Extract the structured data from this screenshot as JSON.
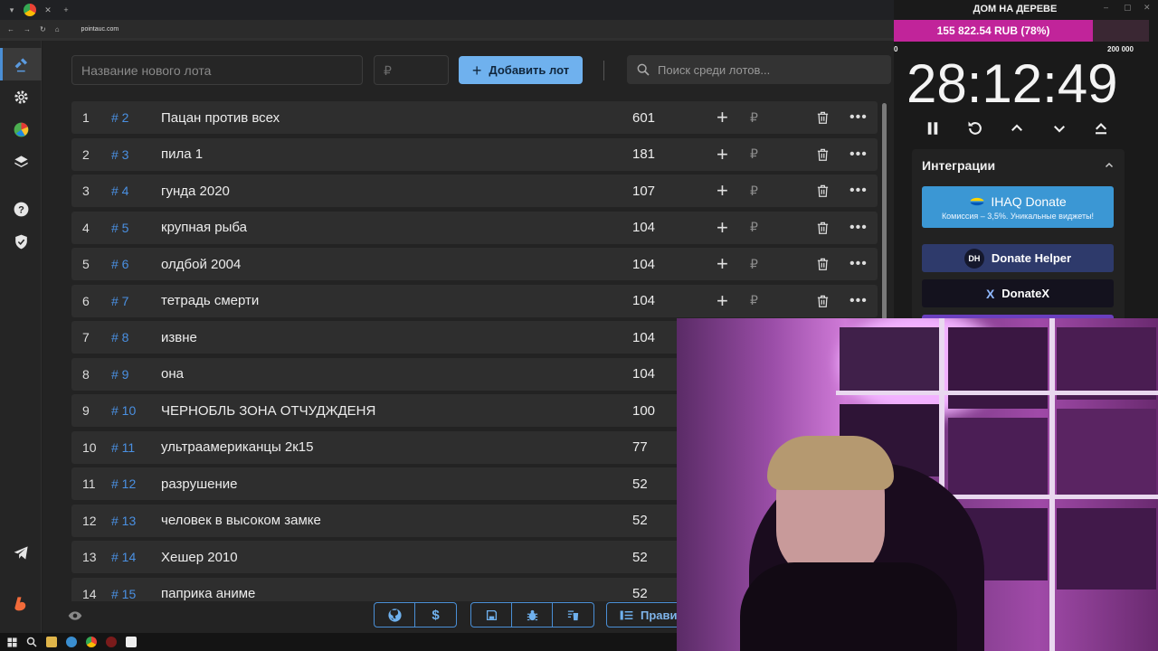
{
  "browser": {
    "url": "pointauc.com"
  },
  "sidebar": {
    "items": [
      {
        "icon": "gavel-icon",
        "active": true
      },
      {
        "icon": "gear-icon"
      },
      {
        "icon": "pie-chart-icon"
      },
      {
        "icon": "layers-icon"
      },
      {
        "icon": "help-icon"
      },
      {
        "icon": "shield-icon"
      },
      {
        "icon": "telegram-icon"
      },
      {
        "icon": "boosty-icon"
      }
    ]
  },
  "toolbar": {
    "lot_name_placeholder": "Название нового лота",
    "amount_placeholder": "₽",
    "add_label": "Добавить лот",
    "search_placeholder": "Поиск среди лотов..."
  },
  "lots": [
    {
      "index": "1",
      "id": "# 2",
      "name": "Пацан против всех",
      "amount": "601"
    },
    {
      "index": "2",
      "id": "# 3",
      "name": "пила 1",
      "amount": "181"
    },
    {
      "index": "3",
      "id": "# 4",
      "name": "гунда 2020",
      "amount": "107"
    },
    {
      "index": "4",
      "id": "# 5",
      "name": "крупная рыба",
      "amount": "104"
    },
    {
      "index": "5",
      "id": "# 6",
      "name": "олдбой 2004",
      "amount": "104"
    },
    {
      "index": "6",
      "id": "# 7",
      "name": "тетрадь смерти",
      "amount": "104"
    },
    {
      "index": "7",
      "id": "# 8",
      "name": "извне",
      "amount": "104"
    },
    {
      "index": "8",
      "id": "# 9",
      "name": "она",
      "amount": "104"
    },
    {
      "index": "9",
      "id": "# 10",
      "name": "ЧЕРНОБЛЬ ЗОНА ОТЧУДЖДЕНЯ",
      "amount": "100"
    },
    {
      "index": "10",
      "id": "# 11",
      "name": "ультраамериканцы 2к15",
      "amount": "77"
    },
    {
      "index": "11",
      "id": "# 12",
      "name": "разрушение",
      "amount": "52"
    },
    {
      "index": "12",
      "id": "# 13",
      "name": "человек в высоком замке",
      "amount": "52"
    },
    {
      "index": "13",
      "id": "# 14",
      "name": "Хешер 2010",
      "amount": "52"
    },
    {
      "index": "14",
      "id": "# 15",
      "name": "паприка аниме",
      "amount": "52"
    }
  ],
  "row_actions": {
    "plus": "+",
    "currency": "₽",
    "more": "•••"
  },
  "bottom": {
    "rules_label": "Прави"
  },
  "right_panel": {
    "title": "ДОМ НА ДЕРЕВЕ",
    "progress_text": "155 822.54 RUB (78%)",
    "progress_fraction": 0.78,
    "progress_min": "0",
    "progress_max": "200 000",
    "timer": "28:12:49",
    "integrations_title": "Интеграции",
    "ihaq_title": "IHAQ Donate",
    "ihaq_subtitle": "Комиссия – 3,5%. Уникальные виджеты!",
    "dh_logo": "DH",
    "dh_title": "Donate Helper",
    "dx_mark": "X",
    "dx_title": "DonateX"
  },
  "colors": {
    "accent": "#6fb1ee",
    "id_blue": "#4a90e2",
    "progress": "#c1249a",
    "ihaq": "#3b97d4"
  }
}
